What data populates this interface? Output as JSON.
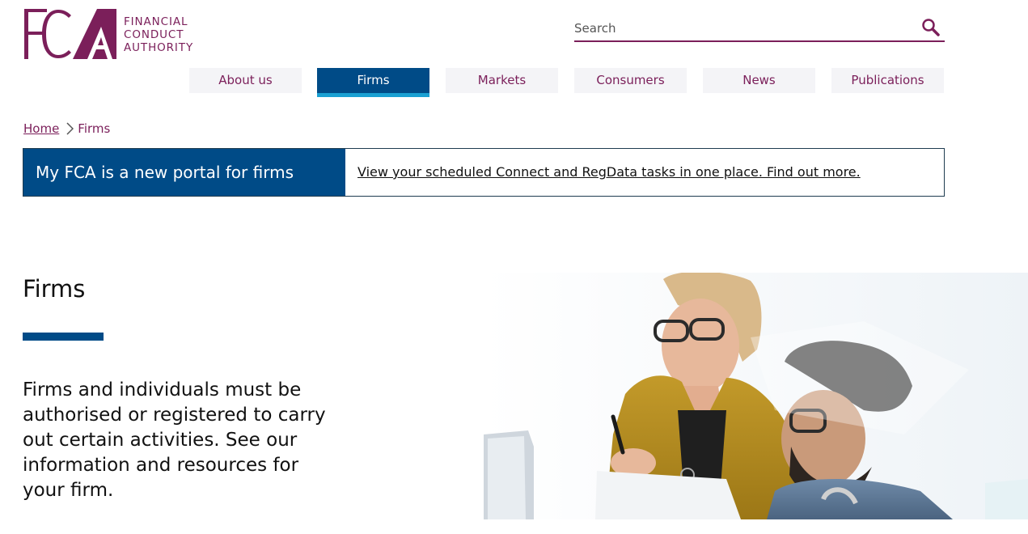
{
  "logo": {
    "mark": "FCA",
    "lines": [
      "FINANCIAL",
      "CONDUCT",
      "AUTHORITY"
    ],
    "brand_color": "#7b1f5a"
  },
  "search": {
    "placeholder": "Search",
    "icon": "search-icon"
  },
  "nav": {
    "items": [
      {
        "label": "About us",
        "active": false
      },
      {
        "label": "Firms",
        "active": true
      },
      {
        "label": "Markets",
        "active": false
      },
      {
        "label": "Consumers",
        "active": false
      },
      {
        "label": "News",
        "active": false
      },
      {
        "label": "Publications",
        "active": false
      }
    ],
    "active_color": "#004b87",
    "active_underline": "#1aa0d2"
  },
  "breadcrumb": {
    "home": "Home",
    "current": "Firms",
    "separator_icon": "chevron-right-icon"
  },
  "banner": {
    "heading": "My FCA is a new portal for firms",
    "link": "View your scheduled Connect and RegData tasks in one place. Find out more."
  },
  "hero": {
    "title": "Firms",
    "text": "Firms and individuals must be authorised or registered to carry out certain activities. See our information and resources for your firm.",
    "image": "photo-two-colleagues-at-laptop"
  }
}
